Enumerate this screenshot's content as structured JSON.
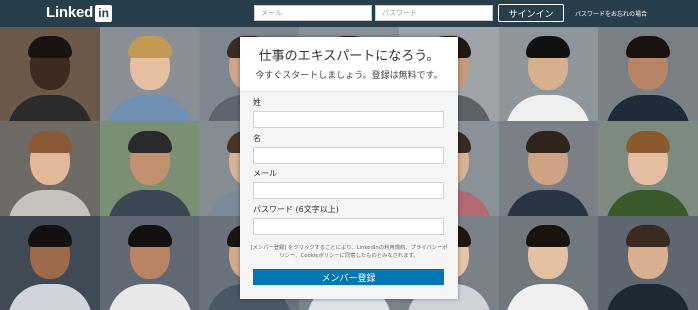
{
  "header": {
    "logo_text": "Linked",
    "logo_in": "in",
    "email_placeholder": "メール",
    "password_placeholder": "パスワード",
    "signin_label": "サインイン",
    "forgot_label": "パスワードをお忘れの場合"
  },
  "signup": {
    "title": "仕事のエキスパートになろう。",
    "subtitle": "今すぐスタートしましょう。登録は無料です。",
    "first_name_label": "姓",
    "last_name_label": "名",
    "email_label": "メール",
    "password_label": "パスワード (6文字以上)",
    "terms_text": "[メンバー登録] をクリックすることにより、LinkedInの利用規約、プライバシーポリシー、Cookieポリシーに同意したものとみなされます。",
    "join_label": "メンバー登録"
  },
  "background": {
    "tiles": [
      {
        "bg": "#6b5a4a",
        "skin": "#3e2a1e",
        "shirt": "#2b2b2b",
        "hair": "#1a1410"
      },
      {
        "bg": "#8a8f96",
        "skin": "#e4bfa2",
        "shirt": "#6f8fb3",
        "hair": "#c49a52"
      },
      {
        "bg": "#7e8790",
        "skin": "#cfa488",
        "shirt": "#5d6670",
        "hair": "#3a2a20"
      },
      {
        "bg": "#8c9196",
        "skin": "#d9b49a",
        "shirt": "#9aa2aa",
        "hair": "#2a2018"
      },
      {
        "bg": "#9ea3a8",
        "skin": "#c89a7c",
        "shirt": "#5b6166",
        "hair": "#1e1814"
      },
      {
        "bg": "#8e959b",
        "skin": "#d8b08e",
        "shirt": "#efefef",
        "hair": "#111111"
      },
      {
        "bg": "#7a7f84",
        "skin": "#b78466",
        "shirt": "#1e2a36",
        "hair": "#1a120e"
      },
      {
        "bg": "#6e6a66",
        "skin": "#e2b89a",
        "shirt": "#c7c2bb",
        "hair": "#8a5a36"
      },
      {
        "bg": "#7b8f74",
        "skin": "#c19170",
        "shirt": "#3a4652",
        "hair": "#2a2a2a"
      },
      {
        "bg": "#868d92",
        "skin": "#d8b294",
        "shirt": "#7b8a98",
        "hair": "#4a3426"
      },
      {
        "bg": "#8a8f96",
        "skin": "#d2a888",
        "shirt": "#7a8794",
        "hair": "#2a2018"
      },
      {
        "bg": "#8a9299",
        "skin": "#d9b293",
        "shirt": "#b26a73",
        "hair": "#3a2a1f"
      },
      {
        "bg": "#7b8088",
        "skin": "#cfa283",
        "shirt": "#2a3544",
        "hair": "#2e241c"
      },
      {
        "bg": "#7d8a80",
        "skin": "#e2bda0",
        "shirt": "#3b5a2b",
        "hair": "#8a5a2e"
      },
      {
        "bg": "#3f4a55",
        "skin": "#9d6b4a",
        "shirt": "#cfd5db",
        "hair": "#141010"
      },
      {
        "bg": "#5f6873",
        "skin": "#b98463",
        "shirt": "#e8e8e8",
        "hair": "#141010"
      },
      {
        "bg": "#6a737d",
        "skin": "#d4a98a",
        "shirt": "#4a5866",
        "hair": "#1a1410"
      },
      {
        "bg": "#7a828a",
        "skin": "#d8b293",
        "shirt": "#dde2e6",
        "hair": "#1d1712"
      },
      {
        "bg": "#7b8188",
        "skin": "#e8c4a6",
        "shirt": "#cfd3d8",
        "hair": "#20160f"
      },
      {
        "bg": "#6f777f",
        "skin": "#e4c0a3",
        "shirt": "#f0f0f0",
        "hair": "#1a140f"
      },
      {
        "bg": "#5e6670",
        "skin": "#d8b090",
        "shirt": "#1e2832",
        "hair": "#3a2a20"
      }
    ]
  }
}
